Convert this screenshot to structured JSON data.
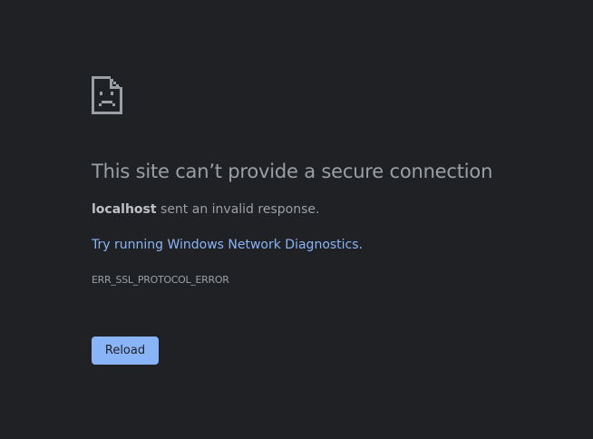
{
  "error": {
    "icon": "sad-file-icon",
    "headline": "This site can’t provide a secure connection",
    "summary_host": "localhost",
    "summary_text": " sent an invalid response.",
    "diagnostics_link": "Try running Windows Network Diagnostics.",
    "error_code": "ERR_SSL_PROTOCOL_ERROR",
    "reload_label": "Reload"
  },
  "colors": {
    "background": "#202124",
    "text": "#9aa0a6",
    "text_strong": "#bdc1c6",
    "link": "#8ab4f8",
    "button": "#8ab4f8",
    "button_text": "#202124"
  }
}
